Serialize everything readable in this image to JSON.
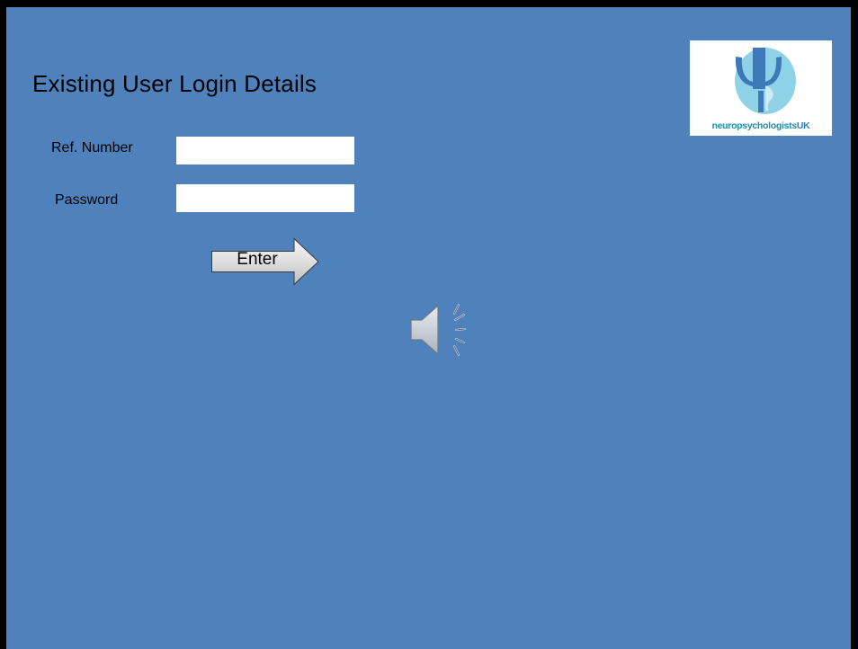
{
  "form": {
    "title": "Existing User Login Details",
    "ref_number_label": "Ref. Number",
    "ref_number_value": "",
    "password_label": "Password",
    "password_value": "",
    "enter_label": "Enter"
  },
  "logo": {
    "text_main": "neuropsychologists",
    "text_suffix": "UK"
  },
  "icons": {
    "speaker": "speaker-icon",
    "logo_symbol": "psi-head-logo-icon"
  },
  "colors": {
    "slide_background": "#4f81bd",
    "window_frame": "#000000",
    "input_background": "#ffffff",
    "logo_text": "#1e8fa8",
    "logo_uk_text": "#2b7fc4",
    "logo_symbol": "#3d79b8",
    "logo_circle": "#8fd2e8"
  }
}
